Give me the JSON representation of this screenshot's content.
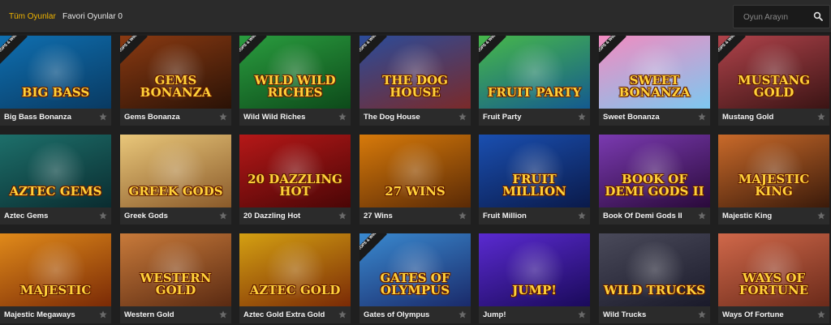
{
  "tabs": [
    {
      "label": "Tüm Oyunlar",
      "active": true
    },
    {
      "label": "Favori Oyunlar 0",
      "active": false
    }
  ],
  "search": {
    "placeholder": "Oyun Arayın",
    "value": ""
  },
  "colors": {
    "accent": "#f0b400",
    "background": "#1f1f1f",
    "caption": "#2b2b2b"
  },
  "ribbon_text": "DROPS & WINS",
  "games": [
    {
      "name": "Big Bass Bonanza",
      "logo": "BIG BASS",
      "bg": [
        "#0f6fb0",
        "#093a62"
      ],
      "ribbon": true
    },
    {
      "name": "Gems Bonanza",
      "logo": "GEMS BONANZA",
      "bg": [
        "#8a3a12",
        "#2a1206"
      ],
      "ribbon": true
    },
    {
      "name": "Wild Wild Riches",
      "logo": "WILD WILD RICHES",
      "bg": [
        "#2a9d3f",
        "#0d4a1a"
      ],
      "ribbon": true
    },
    {
      "name": "The Dog House",
      "logo": "THE DOG HOUSE",
      "bg": [
        "#2b4c9a",
        "#7a2a2a"
      ],
      "ribbon": true
    },
    {
      "name": "Fruit Party",
      "logo": "FRUIT PARTY",
      "bg": [
        "#47b84a",
        "#145a8f"
      ],
      "ribbon": true
    },
    {
      "name": "Sweet Bonanza",
      "logo": "SWEET BONANZA",
      "bg": [
        "#f28bc0",
        "#7dc8f0"
      ],
      "ribbon": true
    },
    {
      "name": "Mustang Gold",
      "logo": "MUSTANG GOLD",
      "bg": [
        "#b0434b",
        "#3a1414"
      ],
      "ribbon": true
    },
    {
      "name": "Aztec Gems",
      "logo": "AZTEC GEMS",
      "bg": [
        "#1d6f6a",
        "#0a2c30"
      ],
      "ribbon": false
    },
    {
      "name": "Greek Gods",
      "logo": "GREEK GODS",
      "bg": [
        "#e9c77a",
        "#8a5a2a"
      ],
      "ribbon": false
    },
    {
      "name": "20 Dazzling Hot",
      "logo": "20 DAZZLING HOT",
      "bg": [
        "#b51818",
        "#4a0606"
      ],
      "ribbon": false
    },
    {
      "name": "27 Wins",
      "logo": "27 WINS",
      "bg": [
        "#d77a0a",
        "#5a2a06"
      ],
      "ribbon": false
    },
    {
      "name": "Fruit Million",
      "logo": "FRUIT MILLION",
      "bg": [
        "#1a4fb0",
        "#0a1a4a"
      ],
      "ribbon": false
    },
    {
      "name": "Book Of Demi Gods II",
      "logo": "BOOK OF DEMI GODS II",
      "bg": [
        "#7a3ab0",
        "#2a0a3a"
      ],
      "ribbon": false
    },
    {
      "name": "Majestic King",
      "logo": "MAJESTIC KING",
      "bg": [
        "#c96a2a",
        "#3a1a0a"
      ],
      "ribbon": false
    },
    {
      "name": "Majestic Megaways",
      "logo": "MAJESTIC",
      "bg": [
        "#e08a1a",
        "#7a2a06"
      ],
      "ribbon": false
    },
    {
      "name": "Western Gold",
      "logo": "WESTERN GOLD",
      "bg": [
        "#c87a3a",
        "#5a2a12"
      ],
      "ribbon": false
    },
    {
      "name": "Aztec Gold Extra Gold",
      "logo": "AZTEC GOLD",
      "bg": [
        "#d4a012",
        "#7a2a06"
      ],
      "ribbon": false
    },
    {
      "name": "Gates of Olympus",
      "logo": "GATES OF OLYMPUS",
      "bg": [
        "#3a8ad0",
        "#1a2a6a"
      ],
      "ribbon": true
    },
    {
      "name": "Jump!",
      "logo": "JUMP!",
      "bg": [
        "#5a2ad0",
        "#1a0a5a"
      ],
      "ribbon": false
    },
    {
      "name": "Wild Trucks",
      "logo": "WILD TRUCKS",
      "bg": [
        "#4a4a5a",
        "#1a1a2a"
      ],
      "ribbon": false
    },
    {
      "name": "Ways Of Fortune",
      "logo": "WAYS OF FORTUNE",
      "bg": [
        "#d0684a",
        "#6a2a1a"
      ],
      "ribbon": false
    }
  ]
}
